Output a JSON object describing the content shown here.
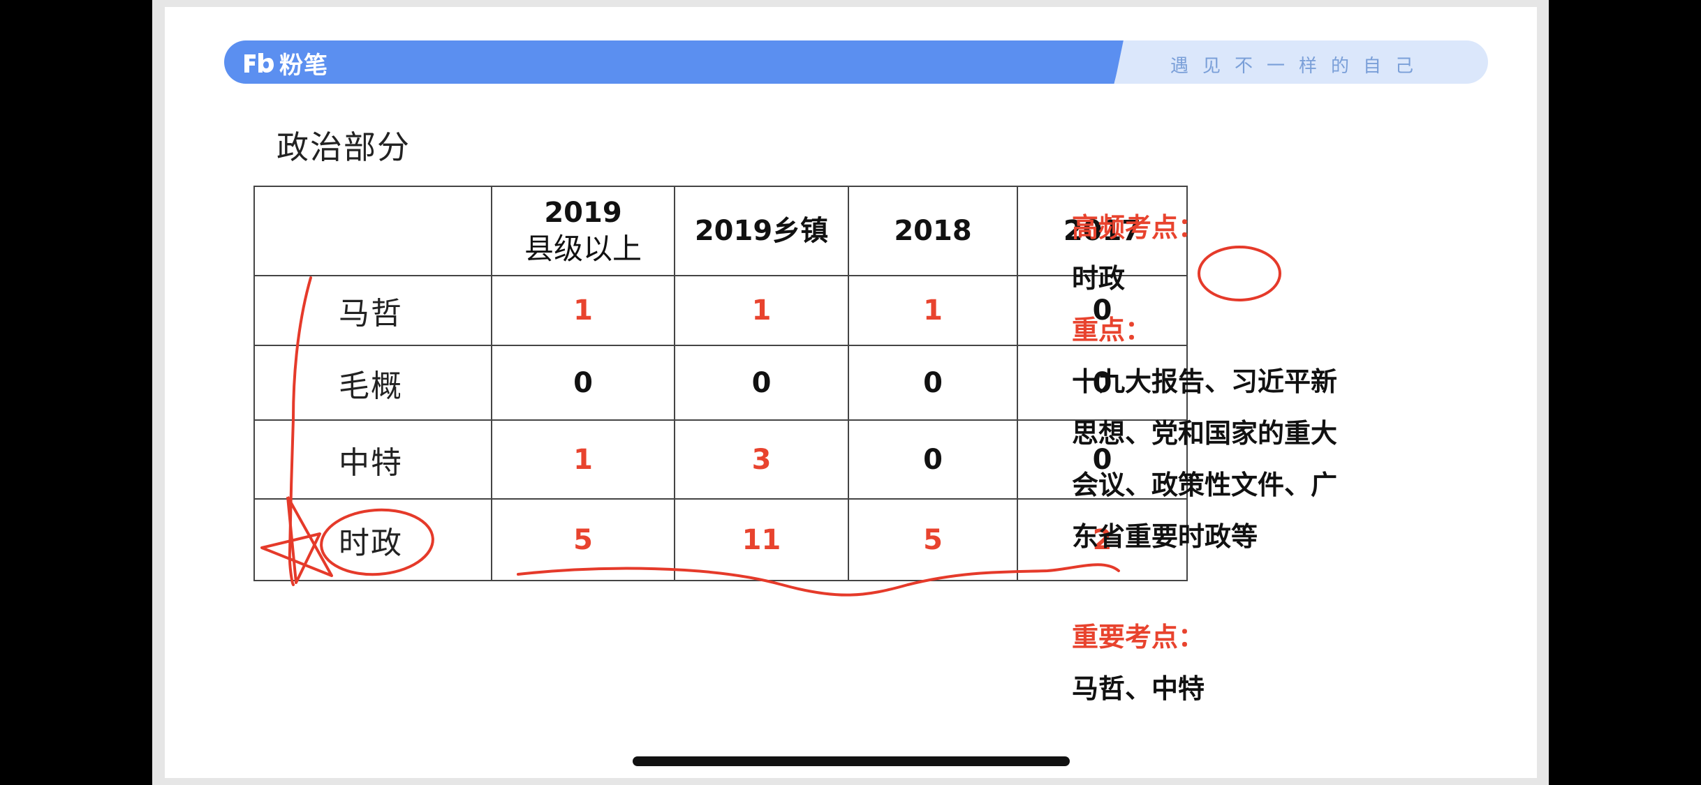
{
  "header": {
    "logo_text": "粉笔",
    "slogan": "遇见不一样的自己"
  },
  "title": "政治部分",
  "table": {
    "columns": [
      "",
      "2019",
      "县级以上",
      "2019乡镇",
      "2018",
      "2017"
    ],
    "rows": [
      {
        "label": "马哲",
        "values": [
          "1",
          "1",
          "1",
          "0"
        ],
        "colors": [
          "#e8432e",
          "#e8432e",
          "#e8432e",
          "#111111"
        ]
      },
      {
        "label": "毛概",
        "values": [
          "0",
          "0",
          "0",
          "0"
        ],
        "colors": [
          "#111111",
          "#111111",
          "#111111",
          "#111111"
        ]
      },
      {
        "label": "中特",
        "values": [
          "1",
          "3",
          "0",
          "0"
        ],
        "colors": [
          "#e8432e",
          "#e8432e",
          "#111111",
          "#111111"
        ]
      },
      {
        "label": "时政",
        "values": [
          "5",
          "11",
          "5",
          "2"
        ],
        "colors": [
          "#e8432e",
          "#e8432e",
          "#e8432e",
          "#e8432e"
        ]
      }
    ]
  },
  "notes": {
    "high_freq_title": "高频考点：",
    "high_freq_body": "时政",
    "key_title": "重点：",
    "key_lines": [
      "十九大报告、习近平新",
      "思想、党和国家的重大",
      "会议、政策性文件、广",
      "东省重要时政等"
    ],
    "important_title": "重要考点：",
    "important_body": "马哲、中特"
  },
  "colors": {
    "accent_red": "#e8432e",
    "banner_blue": "#5b8ff0",
    "banner_light": "#dbe7fb",
    "ink_red": "#e53a2a"
  }
}
